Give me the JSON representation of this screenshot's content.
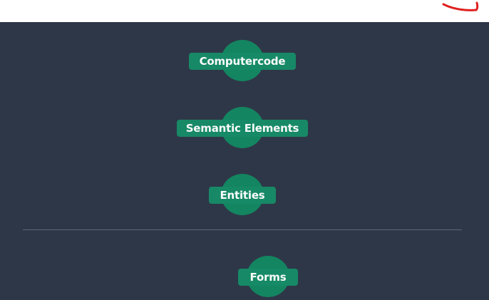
{
  "nodes": [
    {
      "id": "computercode",
      "label": "Computercode"
    },
    {
      "id": "semantic-elements",
      "label": "Semantic Elements"
    },
    {
      "id": "entities",
      "label": "Entities"
    },
    {
      "id": "forms",
      "label": "Forms"
    }
  ],
  "colors": {
    "panel_background": "#2e3748",
    "node_fill": "#138560",
    "node_label_fill": "#178b67",
    "node_text": "#ffffff",
    "divider": "#5d6576",
    "top_strip": "#ffffff",
    "annotation_mark": "#e02020"
  }
}
